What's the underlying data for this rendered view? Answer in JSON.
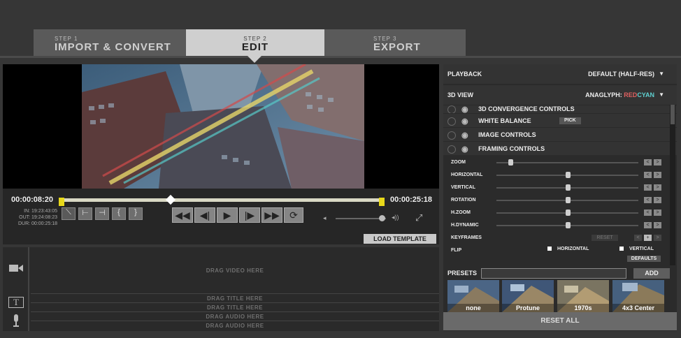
{
  "steps": [
    {
      "num": "STEP 1",
      "label": "IMPORT & CONVERT"
    },
    {
      "num": "STEP 2",
      "label": "EDIT"
    },
    {
      "num": "STEP 3",
      "label": "EXPORT"
    }
  ],
  "player": {
    "current_time": "00:00:08:20",
    "end_time": "00:00:25:18",
    "in": "IN: 19:23:43:05",
    "out": "OUT: 19:24:08:23",
    "dur": "DUR: 00:00:25:18",
    "playhead_fraction": 0.34
  },
  "buttons": {
    "load_template": "LOAD TEMPLATE"
  },
  "timeline": {
    "video_track": "DRAG VIDEO HERE",
    "title_tracks": [
      "DRAG TITLE HERE",
      "DRAG TITLE HERE"
    ],
    "audio_tracks": [
      "DRAG AUDIO HERE",
      "DRAG AUDIO HERE"
    ]
  },
  "right_panel": {
    "playback_label": "PLAYBACK",
    "playback_value": "DEFAULT (HALF-RES)",
    "view_label": "3D VIEW",
    "view_value_prefix": "ANAGLYPH: ",
    "view_value_red": "RED",
    "view_value_cyan": "CYAN",
    "sections": [
      {
        "label": "3D CONVERGENCE CONTROLS"
      },
      {
        "label": "WHITE BALANCE",
        "action": "PICK"
      },
      {
        "label": "IMAGE CONTROLS"
      },
      {
        "label": "FRAMING CONTROLS"
      }
    ],
    "framing": [
      {
        "label": "ZOOM",
        "value": 0.1
      },
      {
        "label": "HORIZONTAL",
        "value": 0.5
      },
      {
        "label": "VERTICAL",
        "value": 0.5
      },
      {
        "label": "ROTATION",
        "value": 0.5
      },
      {
        "label": "H.ZOOM",
        "value": 0.5
      },
      {
        "label": "H.DYNAMIC",
        "value": 0.5
      }
    ],
    "keyframes_label": "KEYFRAMES",
    "reset_label": "RESET",
    "flip_label": "FLIP",
    "flip_horizontal": "HORIZONTAL",
    "flip_vertical": "VERTICAL",
    "defaults_label": "DEFAULTS",
    "presets_label": "PRESETS",
    "add_label": "ADD",
    "presets": [
      "none",
      "Protune",
      "1970s",
      "4x3 Center"
    ],
    "reset_all": "RESET ALL"
  }
}
